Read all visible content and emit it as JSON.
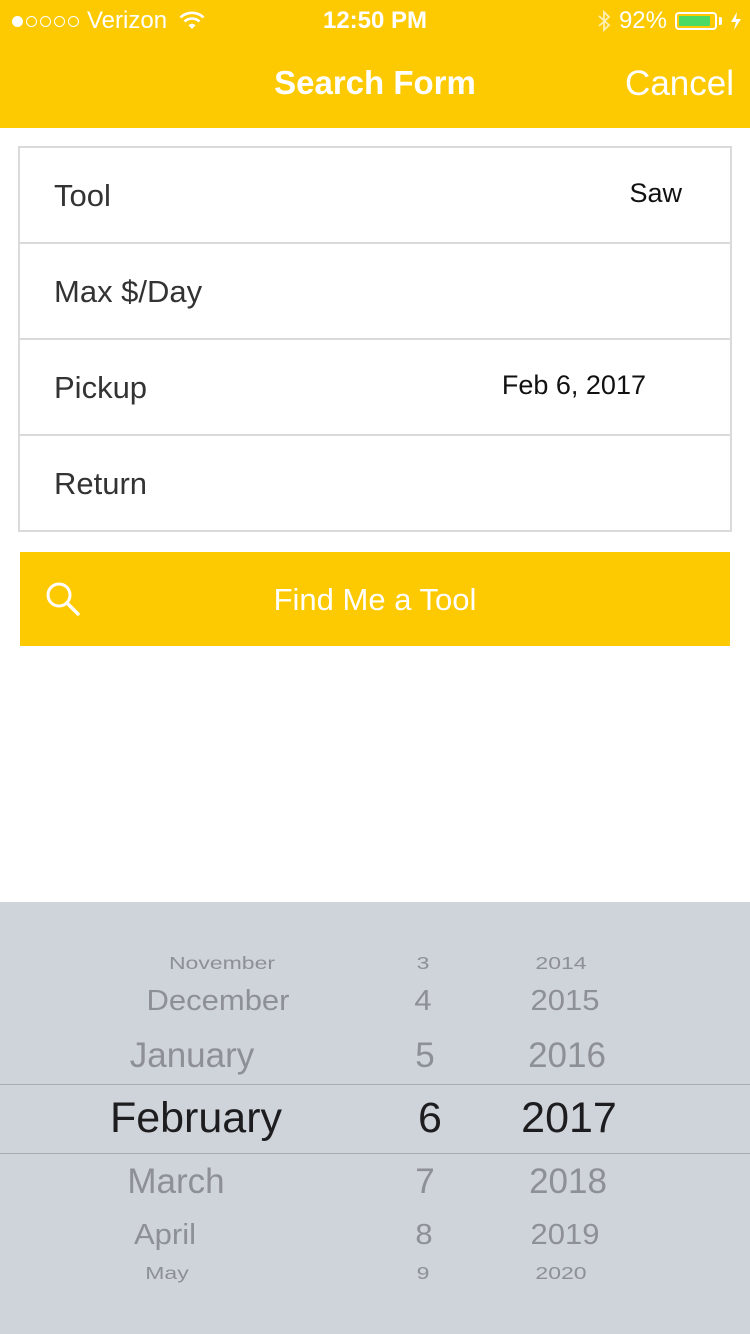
{
  "status": {
    "carrier": "Verizon",
    "time": "12:50 PM",
    "battery": "92%",
    "battery_level": 0.92,
    "signal_bars_filled": 1,
    "signal_bars_total": 5
  },
  "nav": {
    "title": "Search Form",
    "cancel": "Cancel"
  },
  "form": {
    "rows": [
      {
        "label": "Tool",
        "value": "Saw"
      },
      {
        "label": "Max $/Day",
        "value": ""
      },
      {
        "label": "Pickup",
        "value": "Feb 6, 2017"
      },
      {
        "label": "Return",
        "value": ""
      }
    ]
  },
  "button": {
    "label": "Find Me a Tool",
    "icon": "search-icon"
  },
  "picker": {
    "months": [
      "November",
      "December",
      "January",
      "February",
      "March",
      "April",
      "May"
    ],
    "days": [
      "3",
      "4",
      "5",
      "6",
      "7",
      "8",
      "9"
    ],
    "years": [
      "2014",
      "2015",
      "2016",
      "2017",
      "2018",
      "2019",
      "2020"
    ],
    "selected": {
      "month": "February",
      "day": "6",
      "year": "2017"
    }
  },
  "colors": {
    "accent": "#fdc900",
    "picker_bg": "#cfd3da",
    "battery": "#4cd964"
  }
}
